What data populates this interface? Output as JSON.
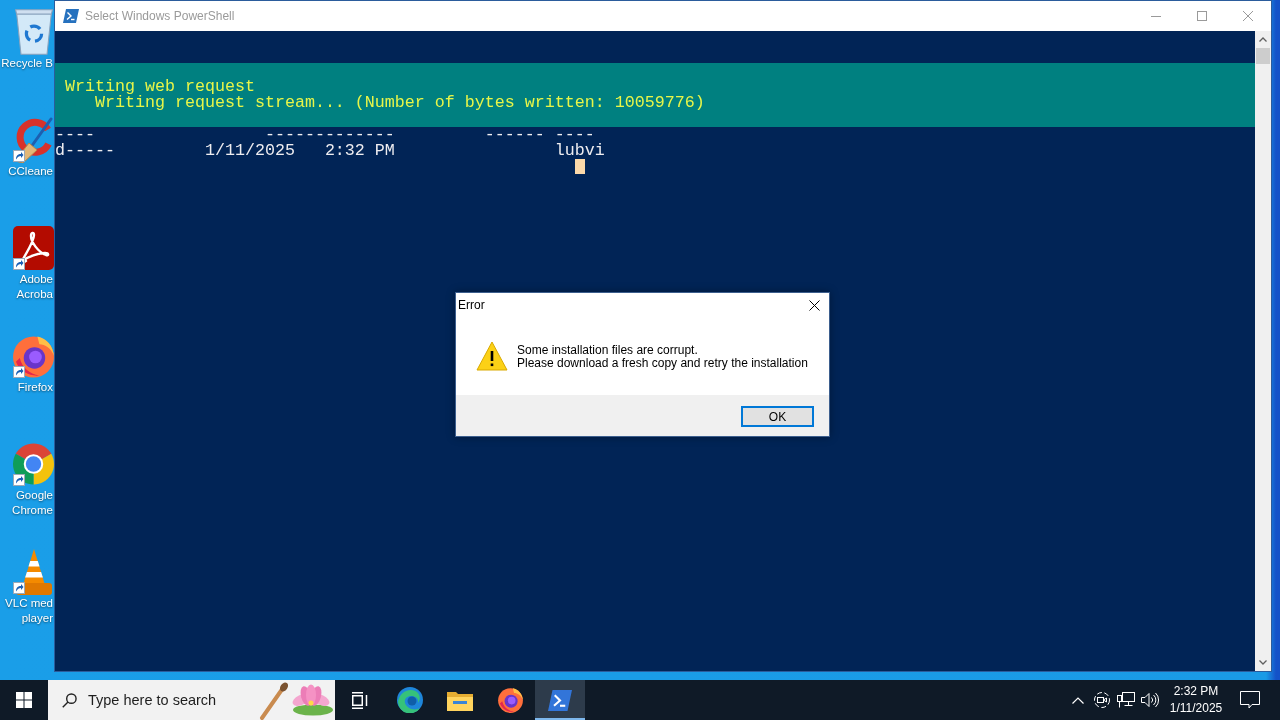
{
  "desktop": {
    "icons": [
      {
        "kind": "recycle_bin",
        "label": [
          "Recycle B"
        ],
        "shortcut": false
      },
      {
        "kind": "ccleaner",
        "label": [
          "CCleane"
        ],
        "shortcut": true
      },
      {
        "kind": "acrobat",
        "label": [
          "Adobe",
          "Acroba"
        ],
        "shortcut": true
      },
      {
        "kind": "firefox",
        "label": [
          "Firefox"
        ],
        "shortcut": true
      },
      {
        "kind": "chrome",
        "label": [
          "Google",
          "Chrome"
        ],
        "shortcut": true
      },
      {
        "kind": "vlc",
        "label": [
          "VLC med",
          "player"
        ],
        "shortcut": true
      }
    ]
  },
  "window": {
    "title": "Select Windows PowerShell",
    "active": false
  },
  "console": {
    "progress": {
      "activity": "Writing web request",
      "status": "Writing request stream... (Number of bytes written: 10059776)"
    },
    "lines": [
      "----                 -------------         ------ ----",
      "d-----         1/11/2025   2:32 PM                lubvi"
    ],
    "cursor_visible": true
  },
  "dialog": {
    "title": "Error",
    "message": [
      "Some installation files are corrupt.",
      "Please download a fresh copy and retry the installation"
    ],
    "buttons": [
      {
        "label": "OK",
        "default": true
      }
    ]
  },
  "taskbar": {
    "search": {
      "placeholder": "Type here to search"
    },
    "apps": [
      {
        "kind": "task_view",
        "selected": false
      },
      {
        "kind": "edge",
        "selected": false
      },
      {
        "kind": "explorer",
        "selected": false
      },
      {
        "kind": "firefox",
        "selected": false
      },
      {
        "kind": "powershell",
        "selected": true
      }
    ],
    "clock": {
      "time": "2:32 PM",
      "date": "1/11/2025"
    }
  }
}
